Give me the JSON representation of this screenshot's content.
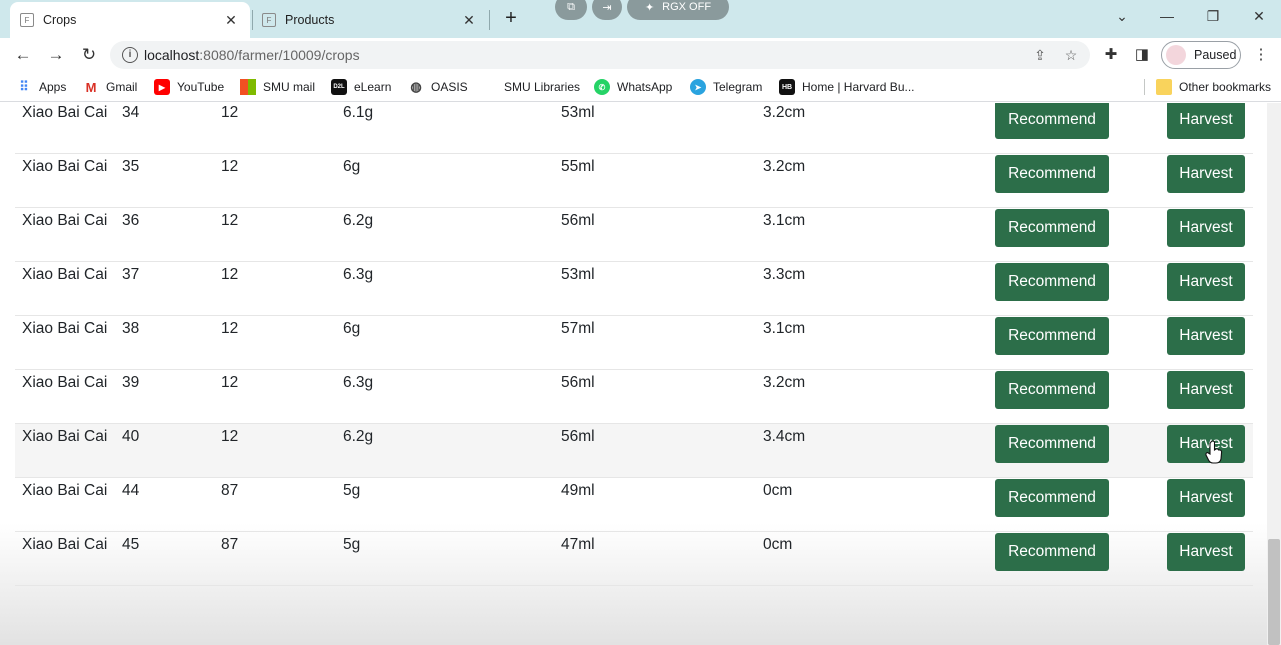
{
  "browser": {
    "tabs": [
      {
        "title": "Crops",
        "favicon": "F",
        "active": true
      },
      {
        "title": "Products",
        "favicon": "F",
        "active": false
      }
    ],
    "new_tab": "+",
    "extension_label": "RGX OFF",
    "address": {
      "host": "localhost",
      "path": ":8080/farmer/10009/crops"
    },
    "profile_label": "Paused",
    "bookmarks": [
      {
        "label": "Apps",
        "icon": "apps-grid-icon"
      },
      {
        "label": "Gmail",
        "icon": "gmail-icon"
      },
      {
        "label": "YouTube",
        "icon": "youtube-icon"
      },
      {
        "label": "SMU mail",
        "icon": "microsoft-icon"
      },
      {
        "label": "eLearn",
        "icon": "d2l-icon",
        "icon_text": "D2L"
      },
      {
        "label": "OASIS",
        "icon": "globe-icon"
      },
      {
        "label": "SMU Libraries",
        "icon": ""
      },
      {
        "label": "WhatsApp",
        "icon": "whatsapp-icon"
      },
      {
        "label": "Telegram",
        "icon": "telegram-icon"
      },
      {
        "label": "Home | Harvard Bu...",
        "icon": "hbr-icon",
        "icon_text": "HB"
      }
    ],
    "other_bookmarks": "Other bookmarks"
  },
  "crops_table": {
    "rows": [
      {
        "name": "Xiao Bai Cai",
        "id": "34",
        "qty": "12",
        "weight": "6.1g",
        "water": "53ml",
        "height": "3.2cm"
      },
      {
        "name": "Xiao Bai Cai",
        "id": "35",
        "qty": "12",
        "weight": "6g",
        "water": "55ml",
        "height": "3.2cm"
      },
      {
        "name": "Xiao Bai Cai",
        "id": "36",
        "qty": "12",
        "weight": "6.2g",
        "water": "56ml",
        "height": "3.1cm"
      },
      {
        "name": "Xiao Bai Cai",
        "id": "37",
        "qty": "12",
        "weight": "6.3g",
        "water": "53ml",
        "height": "3.3cm"
      },
      {
        "name": "Xiao Bai Cai",
        "id": "38",
        "qty": "12",
        "weight": "6g",
        "water": "57ml",
        "height": "3.1cm"
      },
      {
        "name": "Xiao Bai Cai",
        "id": "39",
        "qty": "12",
        "weight": "6.3g",
        "water": "56ml",
        "height": "3.2cm"
      },
      {
        "name": "Xiao Bai Cai",
        "id": "40",
        "qty": "12",
        "weight": "6.2g",
        "water": "56ml",
        "height": "3.4cm"
      },
      {
        "name": "Xiao Bai Cai",
        "id": "44",
        "qty": "87",
        "weight": "5g",
        "water": "49ml",
        "height": "0cm"
      },
      {
        "name": "Xiao Bai Cai",
        "id": "45",
        "qty": "87",
        "weight": "5g",
        "water": "47ml",
        "height": "0cm"
      }
    ],
    "recommend_label": "Recommend",
    "harvest_label": "Harvest",
    "hovered_row_index": 6
  },
  "colors": {
    "button": "#2c6e49",
    "tabstrip": "#cfe8ec"
  }
}
